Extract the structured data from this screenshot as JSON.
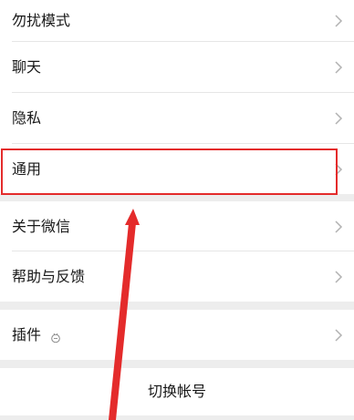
{
  "settings_group_1": {
    "do_not_disturb": "勿扰模式",
    "chat": "聊天",
    "privacy": "隐私",
    "general": "通用"
  },
  "settings_group_2": {
    "about_wechat": "关于微信",
    "help_feedback": "帮助与反馈"
  },
  "settings_group_3": {
    "plugins": "插件",
    "plugins_icon": "plugin-icon"
  },
  "account": {
    "switch_account": "切换帐号"
  },
  "icons": {
    "chevron": "chevron-right-icon"
  },
  "colors": {
    "highlight": "#e42b2b",
    "background": "#ededed",
    "row": "#ffffff",
    "text": "#181818",
    "chevron": "#b2b2b2"
  }
}
